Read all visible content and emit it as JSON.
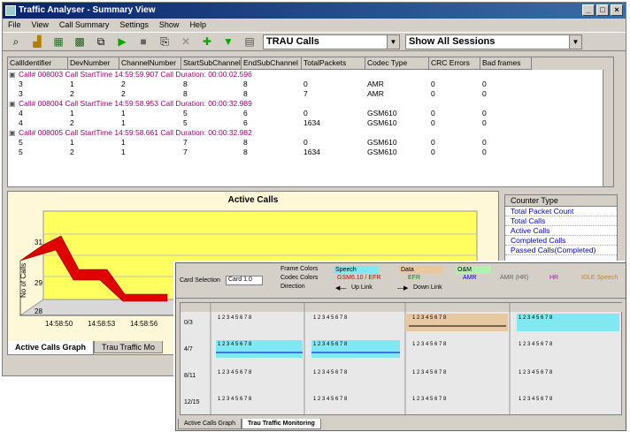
{
  "window": {
    "title": "Traffic Analyser - Summary View",
    "minimize": "_",
    "maximize": "□",
    "close": "×"
  },
  "menu": [
    "File",
    "View",
    "Call Summary",
    "Settings",
    "Show",
    "Help"
  ],
  "toolbar": {
    "icons": [
      "search-icon",
      "chart-icon",
      "export-icon",
      "save-icon",
      "copy-icon",
      "play-icon",
      "stop-icon",
      "find-icon",
      "delete-icon",
      "network-icon",
      "filter-icon",
      "grid-icon"
    ],
    "call_type_select": "TRAU Calls",
    "session_select": "Show All Sessions"
  },
  "grid": {
    "columns": [
      "CallIdentifier",
      "DevNumber",
      "ChannelNumber",
      "StartSubChannel",
      "EndSubChannel",
      "TotalPackets",
      "Codec Type",
      "CRC Errors",
      "Bad frames"
    ],
    "groups": [
      {
        "header": "Call# 008003 Call StartTime 14:59:59.907 Call Duration: 00:00:02.596",
        "rows": [
          [
            "3",
            "1",
            "2",
            "8",
            "8",
            "0",
            "AMR",
            "0",
            "0"
          ],
          [
            "3",
            "2",
            "2",
            "8",
            "8",
            "7",
            "AMR",
            "0",
            "0"
          ]
        ]
      },
      {
        "header": "Call# 008004 Call StartTime 14:59:58.953 Call Duration: 00:00:32.989",
        "rows": [
          [
            "4",
            "1",
            "1",
            "5",
            "6",
            "0",
            "GSM610",
            "0",
            "0"
          ],
          [
            "4",
            "2",
            "1",
            "5",
            "6",
            "1634",
            "GSM610",
            "0",
            "0"
          ]
        ]
      },
      {
        "header": "Call# 008005 Call StartTime 14:59:58.661 Call Duration: 00:00:32.982",
        "rows": [
          [
            "5",
            "1",
            "1",
            "7",
            "8",
            "0",
            "GSM610",
            "0",
            "0"
          ],
          [
            "5",
            "2",
            "1",
            "7",
            "8",
            "1634",
            "GSM610",
            "0",
            "0"
          ]
        ]
      }
    ]
  },
  "graph": {
    "title": "Active Calls",
    "ylabel": "No of Calls",
    "yticks": [
      "31",
      "29",
      "28"
    ],
    "xticks": [
      "14:58:50",
      "14:58:53",
      "14:58:56"
    ]
  },
  "counters": {
    "header": "Counter Type",
    "items": [
      "Total Packet Count",
      "Total Calls",
      "Active Calls",
      "Completed Calls",
      "Passed Calls(Completed)"
    ]
  },
  "tabs": [
    "Active Calls Graph",
    "Trau Traffic Mo"
  ],
  "overlay": {
    "channel_label": "Card Selection",
    "channel_value": "Card 1.0",
    "legend_titles": [
      "Frame Colors",
      "Codec Colors",
      "Direction"
    ],
    "legend_items": [
      "Speech",
      "Data",
      "O&M",
      "GSM6.10 / EFR",
      "EFR",
      "AMR",
      "AMR (HR)",
      "HR",
      "IDLE Speech"
    ],
    "direction_up": "Up Link",
    "direction_down": "Down Link",
    "row_labels": [
      "0/3",
      "4/7",
      "8/11",
      "12/15"
    ],
    "subchannels": "1 2 3 4 5 6 7 8",
    "tabs": [
      "Active Calls Graph",
      "Trau Traffic Monitoring"
    ]
  },
  "colors": {
    "title_bar": "#0a246a",
    "call_header": "#a00070",
    "graph_bg": "#fff8d8",
    "graph_line": "#e00000",
    "speech": "#80e8f0",
    "data": "#e8c8a0",
    "om": "#b0f0b0"
  }
}
